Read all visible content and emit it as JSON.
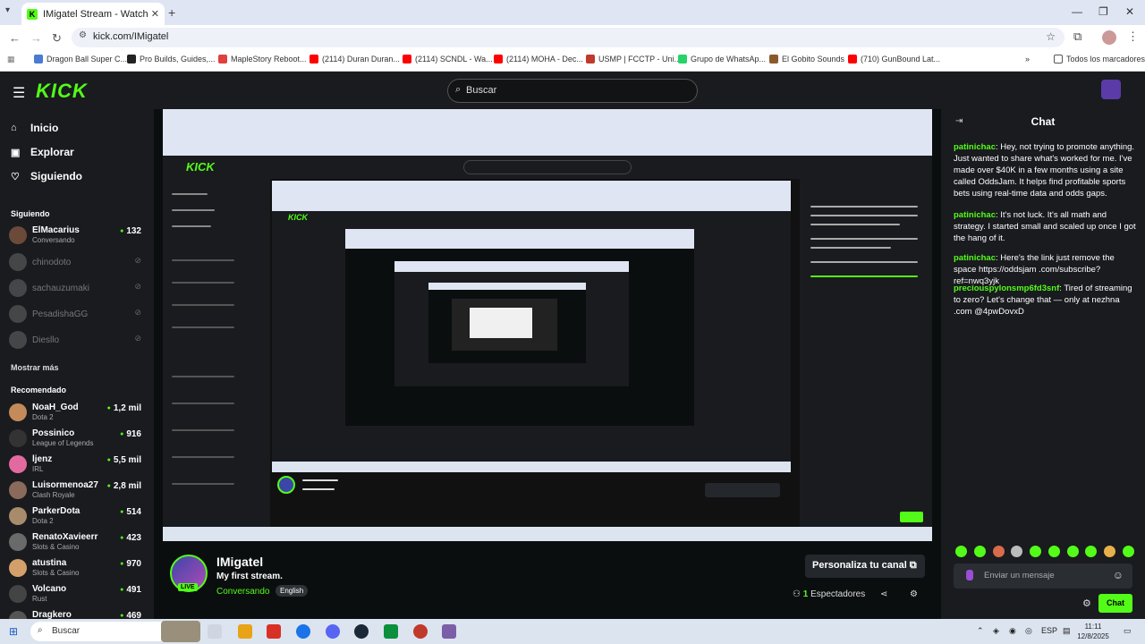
{
  "browser": {
    "tab_title": "IMigatel Stream - Watch Live o",
    "tab_favicon": "K",
    "url": "kick.com/IMigatel",
    "new_tab": "+",
    "bookmarks": [
      {
        "label": "Dragon Ball Super C...",
        "color": "#4a7bd4"
      },
      {
        "label": "Pro Builds, Guides,...",
        "color": "#222222"
      },
      {
        "label": "MapleStory Reboot...",
        "color": "#e04040"
      },
      {
        "label": "(2114) Duran Duran...",
        "color": "#ff0000"
      },
      {
        "label": "(2114) SCNDL - Wa...",
        "color": "#ff0000"
      },
      {
        "label": "(2114) MOHA - Dec...",
        "color": "#ff0000"
      },
      {
        "label": "USMP | FCCTP - Uni...",
        "color": "#c0392b"
      },
      {
        "label": "Grupo de WhatsAp...",
        "color": "#25d366"
      },
      {
        "label": "El Gobito Sounds",
        "color": "#8b5a2b"
      },
      {
        "label": "(710) GunBound Lat...",
        "color": "#ff0000"
      }
    ],
    "bookmarks_folder": "Todos los marcadores"
  },
  "header": {
    "logo": "KICK",
    "search_placeholder": "Buscar"
  },
  "sidebar": {
    "nav": [
      {
        "label": "Inicio",
        "icon": "home-icon"
      },
      {
        "label": "Explorar",
        "icon": "compass-icon"
      },
      {
        "label": "Siguiendo",
        "icon": "heart-icon"
      }
    ],
    "following_title": "Siguiendo",
    "following": [
      {
        "name": "ElMacarius",
        "sub": "Conversando",
        "viewers": "132",
        "online": true
      },
      {
        "name": "chinodoto",
        "online": false
      },
      {
        "name": "sachauzumaki",
        "online": false
      },
      {
        "name": "PesadishaGG",
        "online": false
      },
      {
        "name": "Diesllo",
        "online": false
      }
    ],
    "show_more": "Mostrar más",
    "recommended_title": "Recomendado",
    "recommended": [
      {
        "name": "NoaH_God",
        "sub": "Dota 2",
        "viewers": "1,2 mil"
      },
      {
        "name": "Possinico",
        "sub": "League of Legends",
        "viewers": "916"
      },
      {
        "name": "ljenz",
        "sub": "IRL",
        "viewers": "5,5 mil"
      },
      {
        "name": "Luisormenoa27",
        "sub": "Clash Royale",
        "viewers": "2,8 mil"
      },
      {
        "name": "ParkerDota",
        "sub": "Dota 2",
        "viewers": "514"
      },
      {
        "name": "RenatoXavieerr",
        "sub": "Slots & Casino",
        "viewers": "423"
      },
      {
        "name": "atustina",
        "sub": "Slots & Casino",
        "viewers": "970"
      },
      {
        "name": "Volcano",
        "sub": "Rust",
        "viewers": "491"
      },
      {
        "name": "Dragkero",
        "sub": "",
        "viewers": "469"
      }
    ]
  },
  "stream": {
    "name": "IMigatel",
    "title": "My first stream.",
    "category": "Conversando",
    "tag": "English",
    "live": "LIVE",
    "customize": "Personaliza tu canal",
    "viewers_count": "1",
    "viewers_label": "Espectadores"
  },
  "chat": {
    "title": "Chat",
    "messages": [
      {
        "user": "patinichac",
        "color": "#53fc18",
        "text": "Hey, not trying to promote anything. Just wanted to share what's worked for me. I've made over $40K in a few months using a site called OddsJam. It helps find profitable sports bets using real-time data and odds gaps."
      },
      {
        "user": "patinichac",
        "color": "#53fc18",
        "text": "It's not luck. It's all math and strategy. I started small and scaled up once I got the hang of it."
      },
      {
        "user": "patinichac",
        "color": "#53fc18",
        "text": "Here's the link just remove the space https://oddsjam .com/subscribe?ref=nwq3yjk"
      },
      {
        "user": "preciouspylonsmp6fd3snf",
        "color": "#53fc18",
        "text": "Tired of streaming to zero? Let's change that — only at nezhna .com @4pwDovxD"
      }
    ],
    "input_placeholder": "Enviar un mensaje",
    "send_label": "Chat"
  },
  "taskbar": {
    "search_placeholder": "Buscar",
    "lang": "ESP",
    "time": "11:11",
    "date": "12/8/2025",
    "apps": [
      "#1f6fd1",
      "#e8a317",
      "#d93025",
      "#1a73e8",
      "#5865f2",
      "#1b2838",
      "#0a8f3c",
      "#c0392b",
      "#7b5ea7"
    ]
  },
  "colors": {
    "accent": "#53fc18",
    "panel": "#191b1f",
    "background": "#0b0e0f"
  }
}
